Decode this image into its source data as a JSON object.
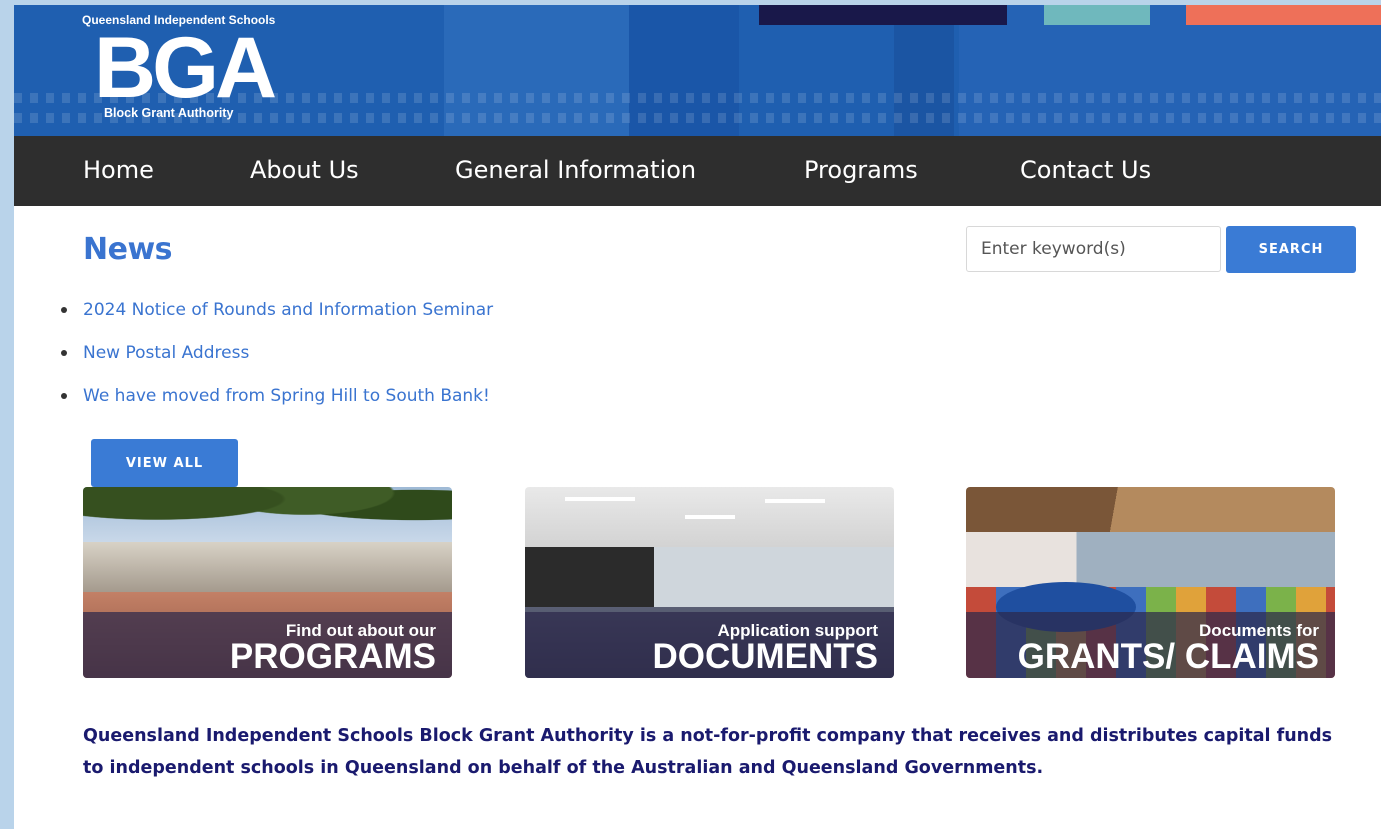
{
  "logo": {
    "tagline": "Queensland Independent Schools",
    "letters": "BGA",
    "subname": "Block Grant Authority"
  },
  "nav": {
    "items": [
      {
        "label": "Home"
      },
      {
        "label": "About Us"
      },
      {
        "label": "General Information"
      },
      {
        "label": "Programs"
      },
      {
        "label": "Contact Us"
      }
    ]
  },
  "news": {
    "title": "News",
    "items": [
      {
        "label": "2024 Notice of Rounds and Information Seminar"
      },
      {
        "label": "New Postal Address"
      },
      {
        "label": "We have moved from Spring Hill to South Bank!"
      }
    ],
    "view_all_label": "VIEW ALL"
  },
  "search": {
    "placeholder": "Enter keyword(s)",
    "button_label": "SEARCH"
  },
  "tiles": [
    {
      "small": "Find out about our",
      "big": "PROGRAMS"
    },
    {
      "small": "Application support",
      "big": "DOCUMENTS"
    },
    {
      "small": "Documents for",
      "big": "GRANTS/ CLAIMS"
    }
  ],
  "about": {
    "text": "Queensland Independent Schools Block Grant Authority is a not-for-profit company that receives and distributes capital funds to independent schools in Queensland on behalf of the Australian and Queensland Governments."
  },
  "colors": {
    "banner_blue": "#1f5fb0",
    "nav_bg": "#2e2e2e",
    "accent_blue": "#3a7bd5",
    "link_blue": "#3a74d0",
    "about_text": "#1a1a6e",
    "stripe_navy": "#19184a",
    "stripe_teal": "#6fb8bd",
    "stripe_orange": "#ee7059"
  }
}
